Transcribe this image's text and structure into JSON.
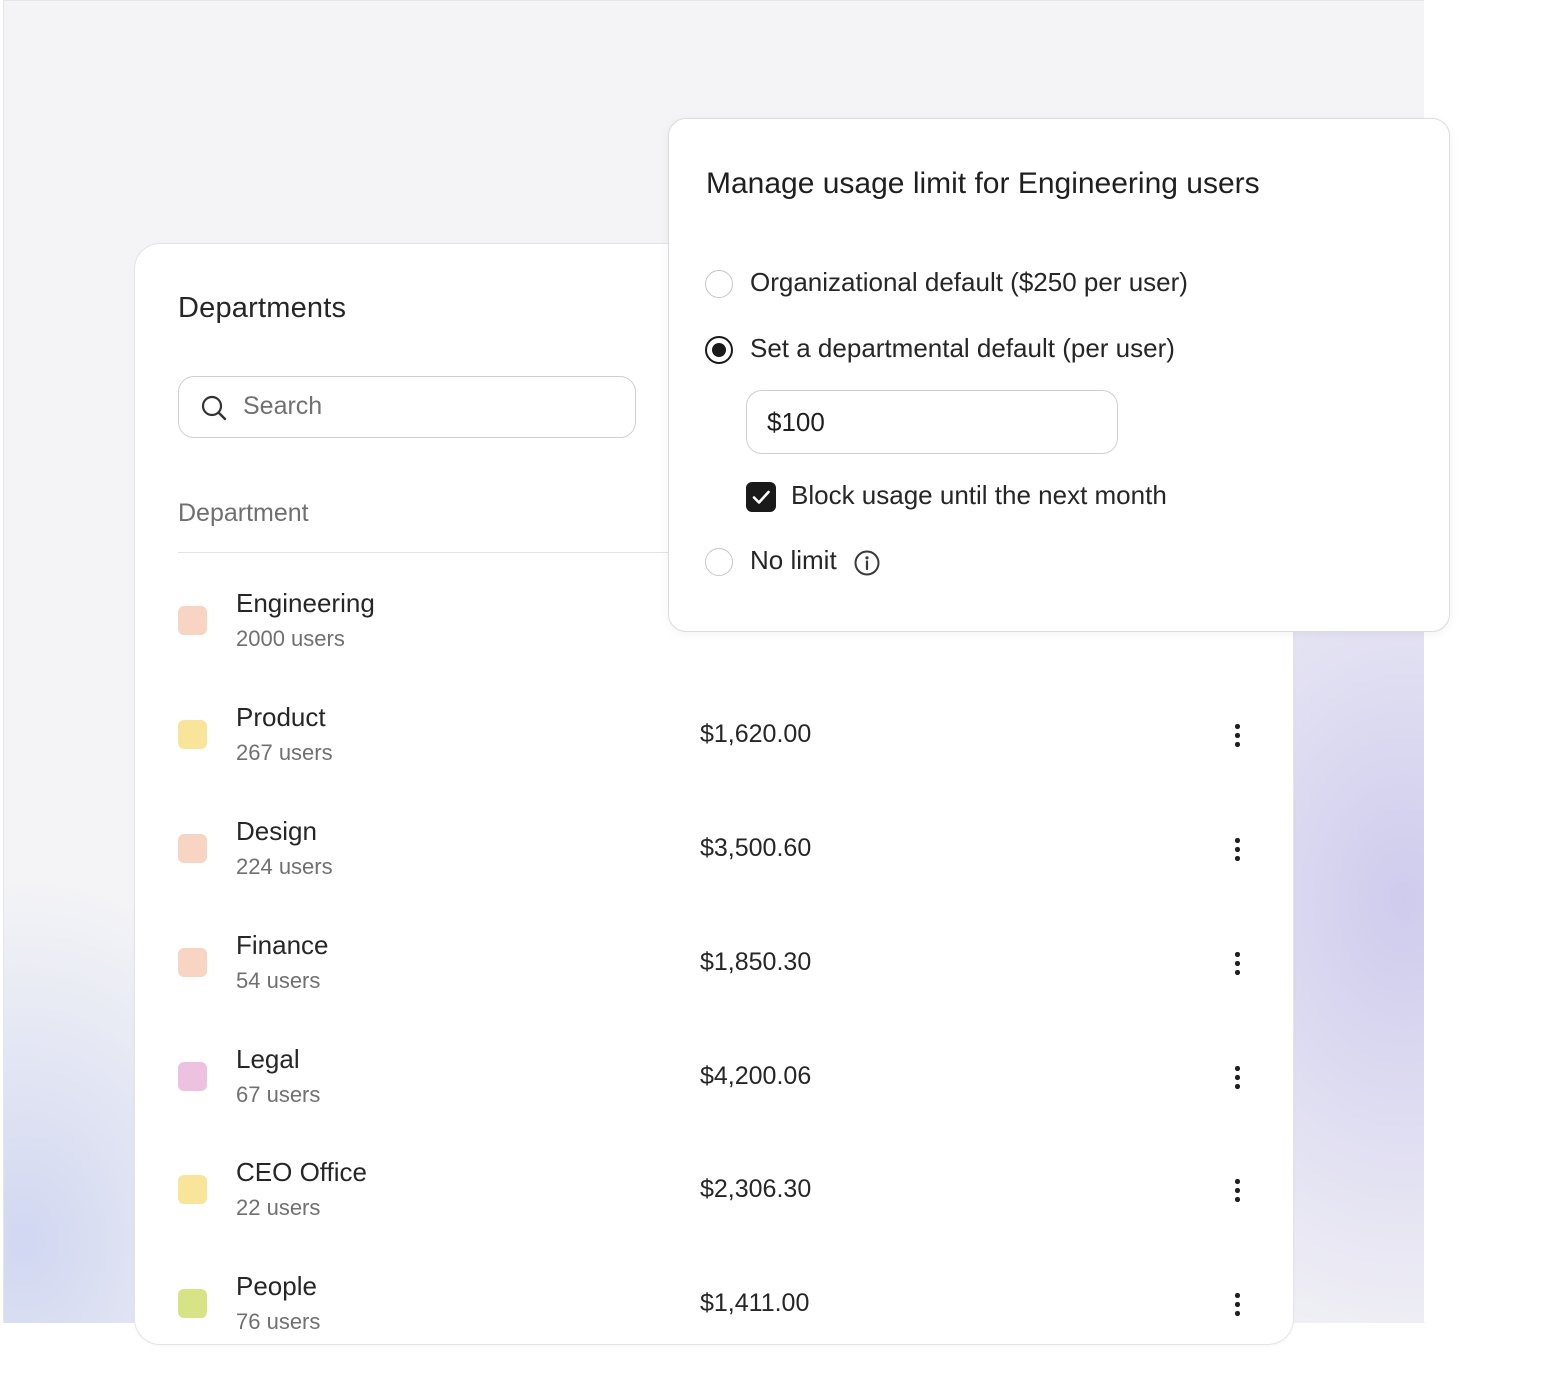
{
  "departments_card": {
    "title": "Departments",
    "search": {
      "placeholder": "Search",
      "value": ""
    },
    "column_header": "Department",
    "rows": [
      {
        "name": "Engineering",
        "users": "2000 users",
        "amount": "",
        "color": "#f8d5c3"
      },
      {
        "name": "Product",
        "users": "267 users",
        "amount": "$1,620.00",
        "color": "#f9e59a"
      },
      {
        "name": "Design",
        "users": "224 users",
        "amount": "$3,500.60",
        "color": "#f8d5c3"
      },
      {
        "name": "Finance",
        "users": "54 users",
        "amount": "$1,850.30",
        "color": "#f8d5c3"
      },
      {
        "name": "Legal",
        "users": "67 users",
        "amount": "$4,200.06",
        "color": "#ecc2e0"
      },
      {
        "name": "CEO Office",
        "users": "22 users",
        "amount": "$2,306.30",
        "color": "#f9e59a"
      },
      {
        "name": "People",
        "users": "76 users",
        "amount": "$1,411.00",
        "color": "#d6e486"
      }
    ]
  },
  "popover": {
    "title": "Manage usage limit for Engineering users",
    "options": [
      {
        "label": "Organizational default ($250 per user)",
        "selected": false
      },
      {
        "label": "Set a departmental default (per user)",
        "selected": true
      },
      {
        "label": "No limit",
        "selected": false
      }
    ],
    "amount_value": "$100",
    "block_checkbox": {
      "label": "Block usage until the next month",
      "checked": true
    }
  }
}
